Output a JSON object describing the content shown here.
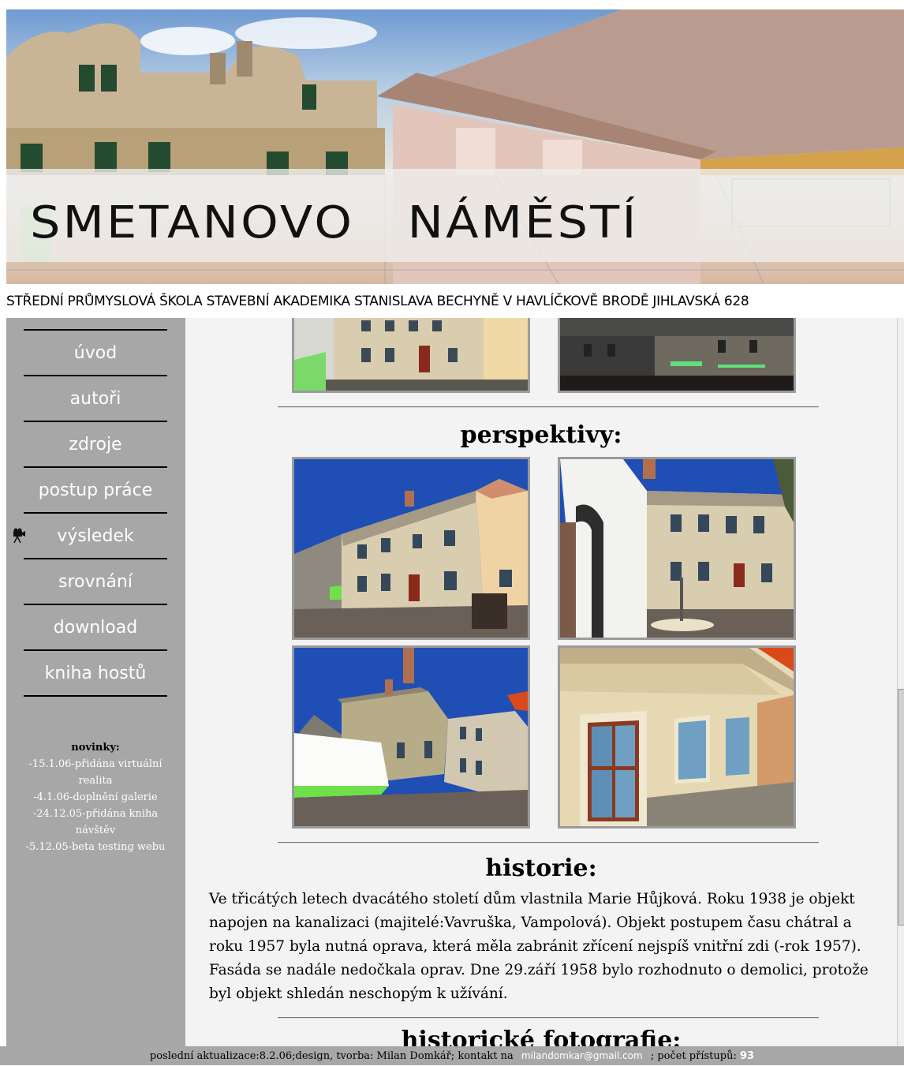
{
  "header": {
    "site_title": "SMETANOVO   NÁMĚSTÍ",
    "school_line": "STŘEDNÍ PRŮMYSLOVÁ ŠKOLA STAVEBNÍ AKADEMIKA STANISLAVA BECHYNĚ V HAVLÍČKOVĚ BRODĚ JIHLAVSKÁ 628"
  },
  "nav": {
    "items": [
      {
        "label": "úvod"
      },
      {
        "label": "autoři"
      },
      {
        "label": "zdroje"
      },
      {
        "label": "postup práce"
      },
      {
        "label": "výsledek",
        "icon": "camera-icon"
      },
      {
        "label": "srovnání"
      },
      {
        "label": "download"
      },
      {
        "label": "kniha hostů"
      }
    ]
  },
  "news": {
    "title": "novinky:",
    "items": [
      "-15.1.06-přidána virtuální realita",
      "-4.1.06-doplnění galerie",
      "-24.12.05-přidána kniha návštěv",
      "-5.12.05-beta testing webu"
    ]
  },
  "main": {
    "perspectives_title": "perspektivy:",
    "history_title": "historie:",
    "history_text": "Ve třicátých letech dvacátého století dům vlastnila Marie Hůjková. Roku 1938 je objekt napojen na kanalizaci (majitelé:Vavruška, Vampolová). Objekt postupem času chátral a roku 1957 byla nutná oprava, která měla zabránit zřícení nejspíš vnitřní zdi (-rok 1957). Fasáda se nadále nedočkala oprav. Dne 29.září 1958 bylo rozhodnuto o demolici, protože byl objekt shledán neschopým k užívání.",
    "photos_title": "historické fotografie:"
  },
  "footer": {
    "text_before": "poslední aktualizace:8.2.06;design, tvorba: Milan Domkář; kontakt na",
    "email": "milandomkar@gmail.com",
    "text_after": "; počet přístupů:",
    "count": "93"
  },
  "colors": {
    "sidebar": "#a7a7a7",
    "content_bg": "#f3f3f3",
    "sky": "#1f4fb5",
    "facade": "#d9cdb0"
  }
}
